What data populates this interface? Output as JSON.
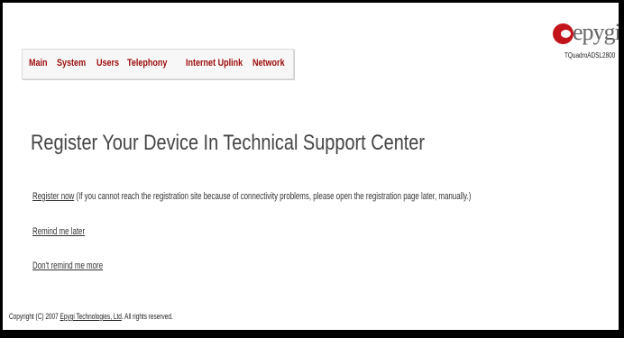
{
  "menu": {
    "items": [
      {
        "label": "Main"
      },
      {
        "label": "System"
      },
      {
        "label": "Users"
      },
      {
        "label": "Telephony"
      },
      {
        "label": "Internet Uplink"
      },
      {
        "label": "Network"
      }
    ]
  },
  "logo": {
    "word": "epygi",
    "model": "TQuadroADSL2800"
  },
  "title": "Register Your Device In Technical Support Center",
  "register": {
    "link": "Register now",
    "note": " (If you cannot reach the registration site because of connectivity problems, please open the registration page later, manually.)"
  },
  "remind_later": "Remind me later",
  "dont_remind": "Don't remind me more",
  "footer": {
    "prefix": "Copyright (C) 2007 ",
    "company": "Epygi Technologies, Ltd",
    "suffix": ". All rights reserved."
  },
  "colors": {
    "menu_text": "#9b0a0a",
    "logo_red": "#c4141b",
    "title_text": "#444444"
  }
}
